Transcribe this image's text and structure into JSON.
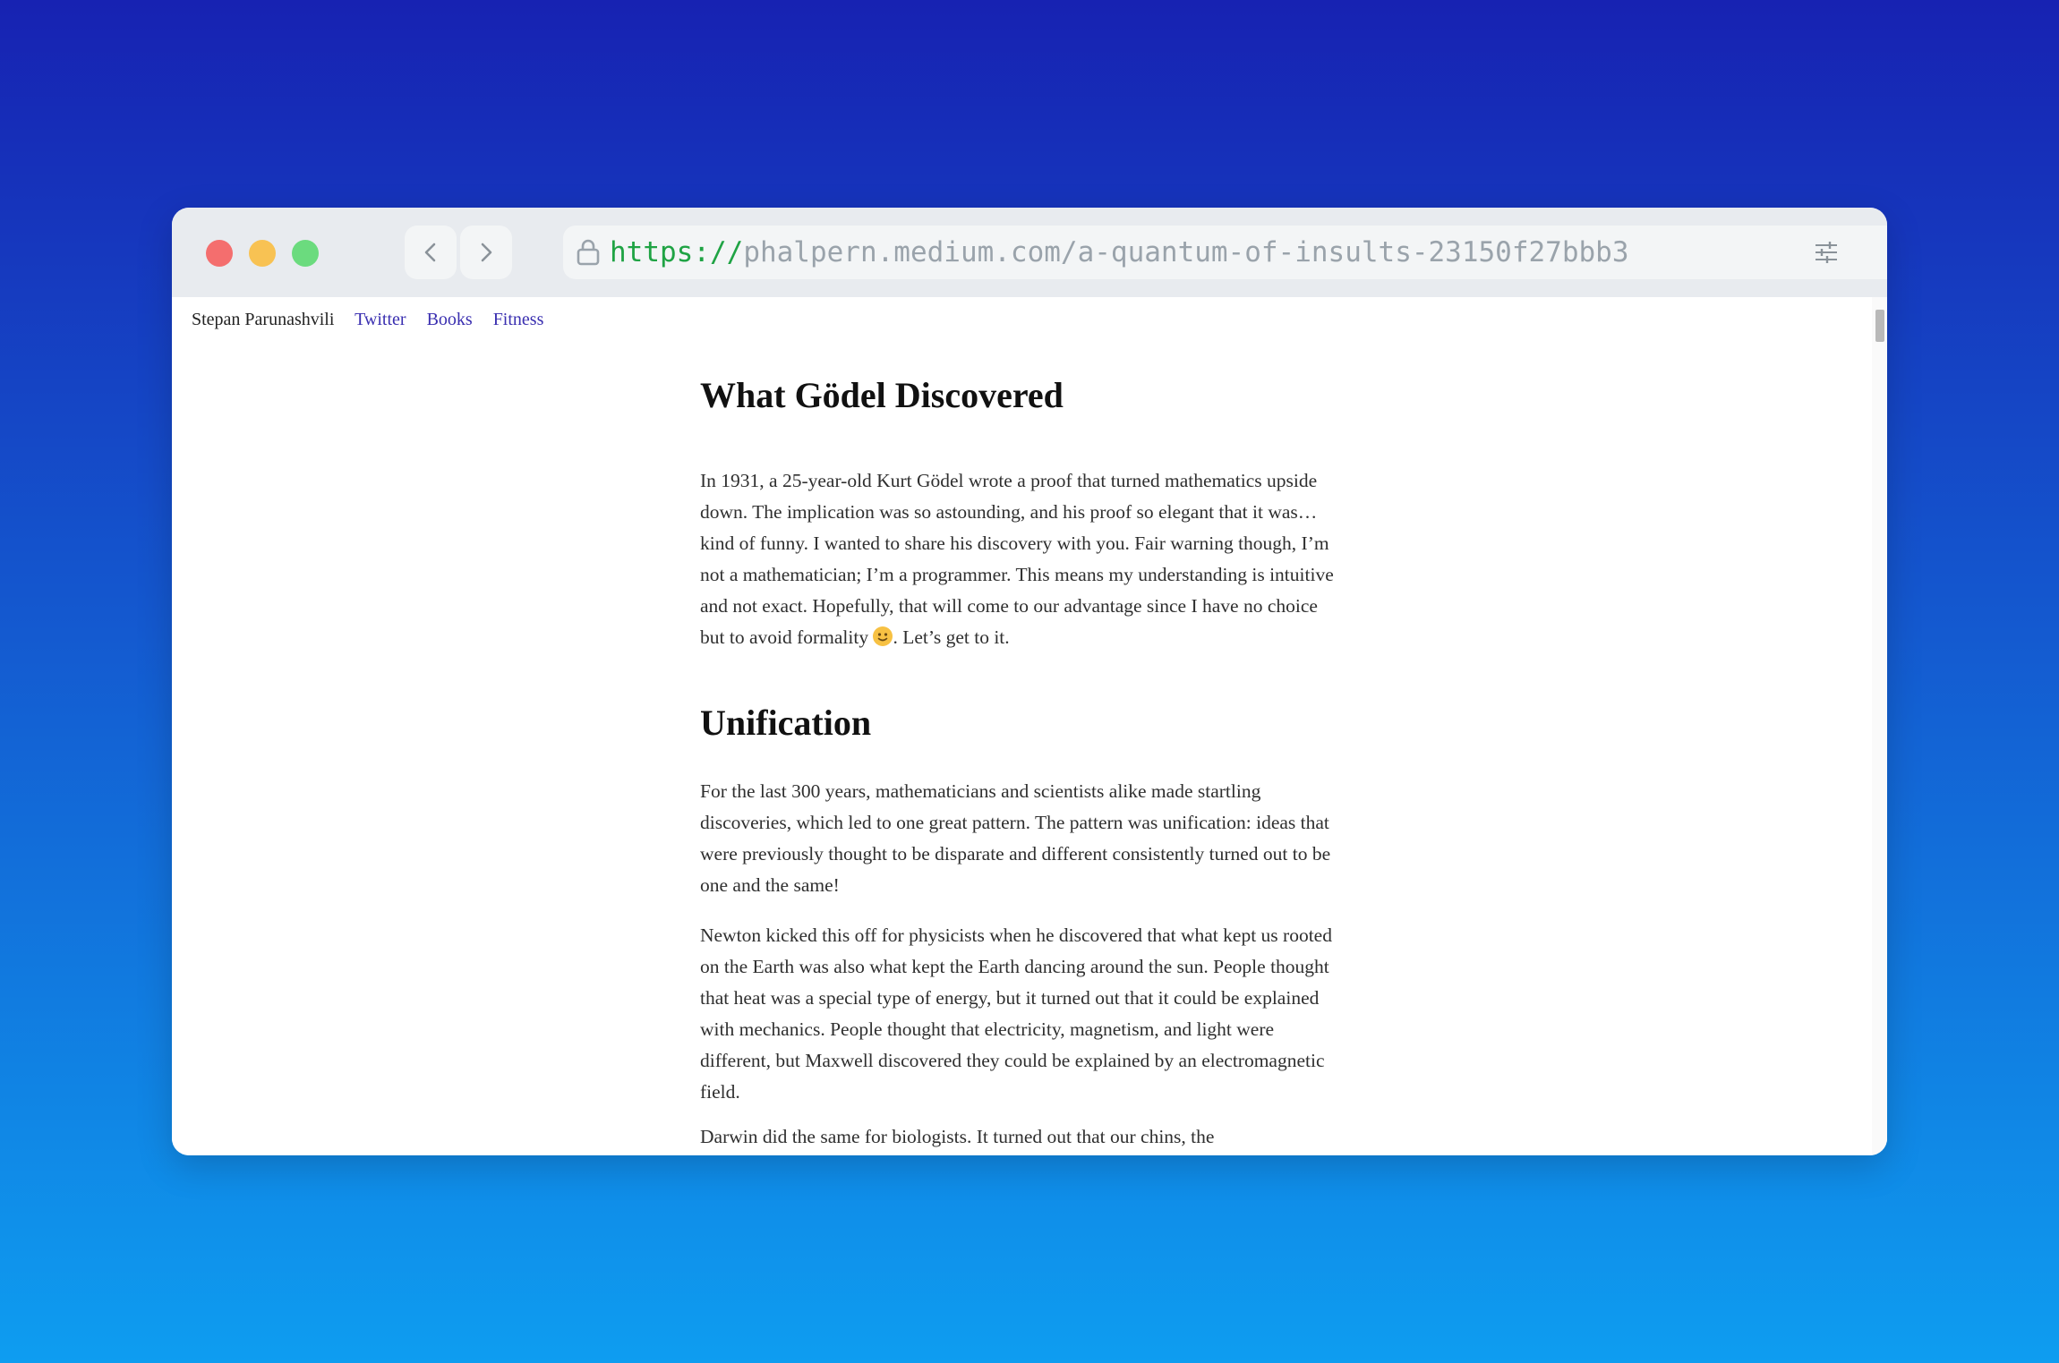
{
  "browser": {
    "url_scheme": "https://",
    "url_rest": "phalpern.medium.com/a-quantum-of-insults-23150f27bbb3",
    "icons": {
      "back": "chevron-left-icon",
      "forward": "chevron-right-icon",
      "lock": "lock-icon",
      "settings": "sliders-icon"
    },
    "colors": {
      "close": "#f46e6e",
      "minimize": "#f8c253",
      "maximize": "#6bdb7e",
      "url_scheme": "#1fa344"
    }
  },
  "site": {
    "name": "Stepan Parunashvili",
    "nav": [
      "Twitter",
      "Books",
      "Fitness"
    ]
  },
  "article": {
    "title": "What Gödel Discovered",
    "p1_before": "In 1931, a 25-year-old Kurt Gödel wrote a proof that turned mathematics upside down. The implication was so astounding, and his proof so elegant that it was…kind of funny. I wanted to share his discovery with you. Fair warning though, I’m not a mathematician; I’m a programmer. This means my understanding is intuitive and not exact. Hopefully, that will come to our advantage since I have no choice but to avoid formality ",
    "p1_after": ". Let’s get to it.",
    "section_heading": "Unification",
    "p2": "For the last 300 years, mathematicians and scientists alike made startling discoveries, which led to one great pattern. The pattern was unification: ideas that were previously thought to be disparate and different consistently turned out to be one and the same!",
    "p3": "Newton kicked this off for physicists when he discovered that what kept us rooted on the Earth was also what kept the Earth dancing around the sun. People thought that heat was a special type of energy, but it turned out that it could be explained with mechanics. People thought that electricity, magnetism, and light were different, but Maxwell discovered they could be explained by an electromagnetic field.",
    "p4": "Darwin did the same for biologists. It turned out that our chins, the"
  }
}
